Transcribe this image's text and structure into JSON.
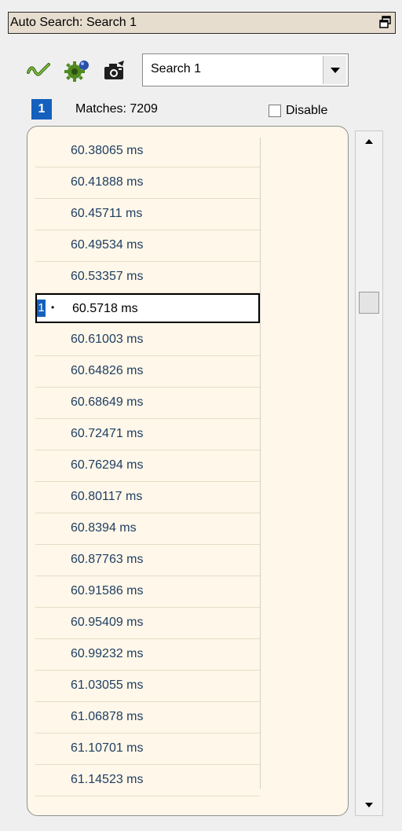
{
  "window": {
    "title": "Auto Search: Search 1"
  },
  "toolbar": {
    "icons": [
      "waveform-icon",
      "gear-icon",
      "camera-icon"
    ],
    "search_select": {
      "value": "Search 1"
    }
  },
  "status": {
    "badge": "1",
    "matches": "Matches: 7209",
    "disable_label": "Disable",
    "disable_checked": false
  },
  "list": {
    "selected_index": 5,
    "cursor_label": "1",
    "cursor_bullet": "•",
    "rows": [
      "60.38065 ms",
      "60.41888 ms",
      "60.45711 ms",
      "60.49534 ms",
      "60.53357 ms",
      "60.5718 ms",
      "60.61003 ms",
      "60.64826 ms",
      "60.68649 ms",
      "60.72471 ms",
      "60.76294 ms",
      "60.80117 ms",
      "60.8394 ms",
      "60.87763 ms",
      "60.91586 ms",
      "60.95409 ms",
      "60.99232 ms",
      "61.03055 ms",
      "61.06878 ms",
      "61.10701 ms",
      "61.14523 ms"
    ]
  },
  "colors": {
    "badge_blue": "#1560bd",
    "title_bg": "#e6ddcf",
    "list_bg": "#fff7e9",
    "row_text": "#1f3f63"
  }
}
